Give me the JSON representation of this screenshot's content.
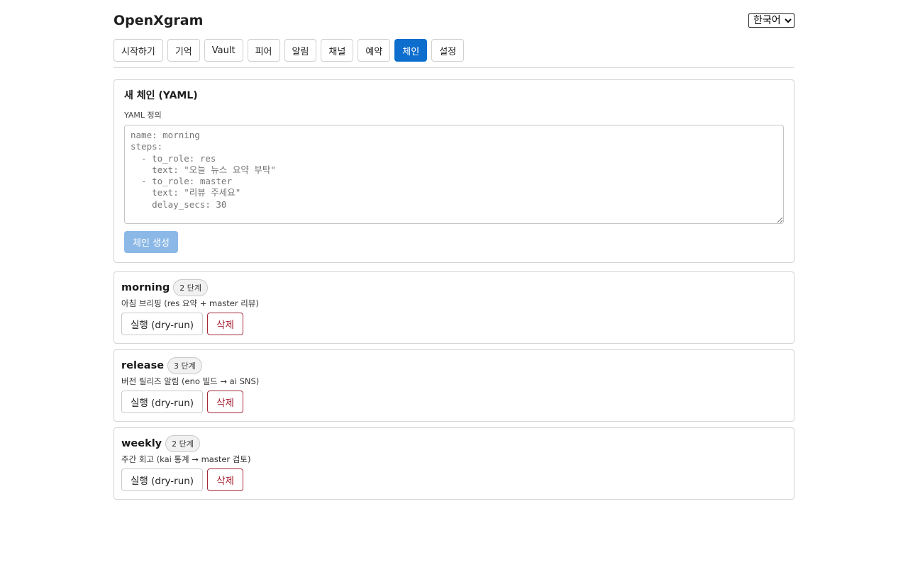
{
  "app": {
    "title": "OpenXgram"
  },
  "language": {
    "selected": "한국어",
    "options": [
      "한국어"
    ]
  },
  "tabs": [
    {
      "label": "시작하기",
      "active": false
    },
    {
      "label": "기억",
      "active": false
    },
    {
      "label": "Vault",
      "active": false
    },
    {
      "label": "피어",
      "active": false
    },
    {
      "label": "알림",
      "active": false
    },
    {
      "label": "채널",
      "active": false
    },
    {
      "label": "예약",
      "active": false
    },
    {
      "label": "체인",
      "active": true
    },
    {
      "label": "설정",
      "active": false
    }
  ],
  "new_chain": {
    "title": "새 체인 (YAML)",
    "field_label": "YAML 정의",
    "placeholder": "name: morning\nsteps:\n  - to_role: res\n    text: \"오늘 뉴스 요약 부탁\"\n  - to_role: master\n    text: \"리뷰 주세요\"\n    delay_secs: 30",
    "value": "",
    "create_label": "체인 생성"
  },
  "chains": [
    {
      "name": "morning",
      "steps": "2 단계",
      "description": "아침 브리핑 (res 요약 + master 리뷰)",
      "run_label": "실행 (dry-run)",
      "delete_label": "삭제"
    },
    {
      "name": "release",
      "steps": "3 단계",
      "description": "버전 릴리즈 알림 (eno 빌드 → ai SNS)",
      "run_label": "실행 (dry-run)",
      "delete_label": "삭제"
    },
    {
      "name": "weekly",
      "steps": "2 단계",
      "description": "주간 회고 (kai 통계 → master 검토)",
      "run_label": "실행 (dry-run)",
      "delete_label": "삭제"
    }
  ],
  "colors": {
    "accent": "#0d6ecd",
    "accent_disabled": "#8bb8e6",
    "danger": "#a31d2e"
  }
}
